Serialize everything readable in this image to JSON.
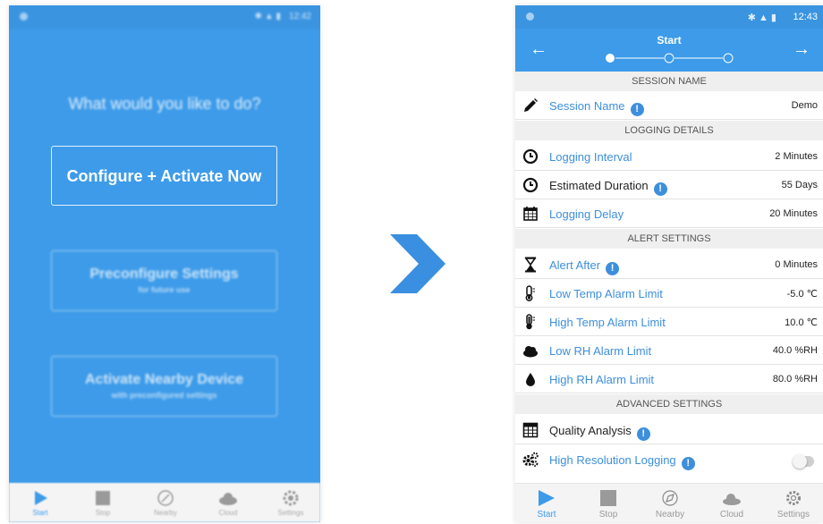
{
  "left_screen": {
    "status_time": "12:42",
    "prompt": "What would you like to do?",
    "configure_button": "Configure + Activate Now",
    "preconfigure_button": {
      "label": "Preconfigure Settings",
      "sublabel": "for future use"
    },
    "activate_nearby_button": {
      "label": "Activate Nearby Device",
      "sublabel": "with preconfigured settings"
    },
    "nav": [
      "Start",
      "Stop",
      "Nearby",
      "Cloud",
      "Settings"
    ]
  },
  "right_screen": {
    "status_time": "12:43",
    "title": "Start",
    "back_icon": "arrow-left-icon",
    "forward_icon": "arrow-right-icon",
    "stepper": {
      "steps": 3,
      "current": 1
    },
    "sections": {
      "session_name": "SESSION NAME",
      "logging_details": "LOGGING DETAILS",
      "alert_settings": "ALERT SETTINGS",
      "advanced_settings": "ADVANCED SETTINGS"
    },
    "rows": {
      "session_name": {
        "label": "Session Name",
        "value": "Demo",
        "icon": "pencil-icon"
      },
      "logging_interval": {
        "label": "Logging Interval",
        "value": "2 Minutes",
        "icon": "clock-icon"
      },
      "estimated_duration": {
        "label": "Estimated Duration",
        "value": "55 Days",
        "icon": "clock-icon"
      },
      "logging_delay": {
        "label": "Logging Delay",
        "value": "20 Minutes",
        "icon": "calendar-icon"
      },
      "alert_after": {
        "label": "Alert After",
        "value": "0 Minutes",
        "icon": "hourglass-icon"
      },
      "low_temp": {
        "label": "Low Temp Alarm Limit",
        "value": "-5.0 ℃",
        "icon": "thermometer-low-icon"
      },
      "high_temp": {
        "label": "High Temp Alarm Limit",
        "value": "10.0 ℃",
        "icon": "thermometer-high-icon"
      },
      "low_rh": {
        "label": "Low RH Alarm Limit",
        "value": "40.0 %RH",
        "icon": "cloud-icon"
      },
      "high_rh": {
        "label": "High RH Alarm Limit",
        "value": "80.0 %RH",
        "icon": "droplet-icon"
      },
      "quality_analysis": {
        "label": "Quality Analysis",
        "icon": "calculator-icon"
      },
      "high_resolution": {
        "label": "High Resolution Logging",
        "icon": "gears-icon",
        "enabled": false
      }
    },
    "info_glyph": "!",
    "nav": [
      "Start",
      "Stop",
      "Nearby",
      "Cloud",
      "Settings"
    ]
  },
  "colors": {
    "primary": "#3d9be9",
    "link": "#3d8fdc",
    "section_bg": "#efefef",
    "arrow": "#3a8fe0"
  }
}
